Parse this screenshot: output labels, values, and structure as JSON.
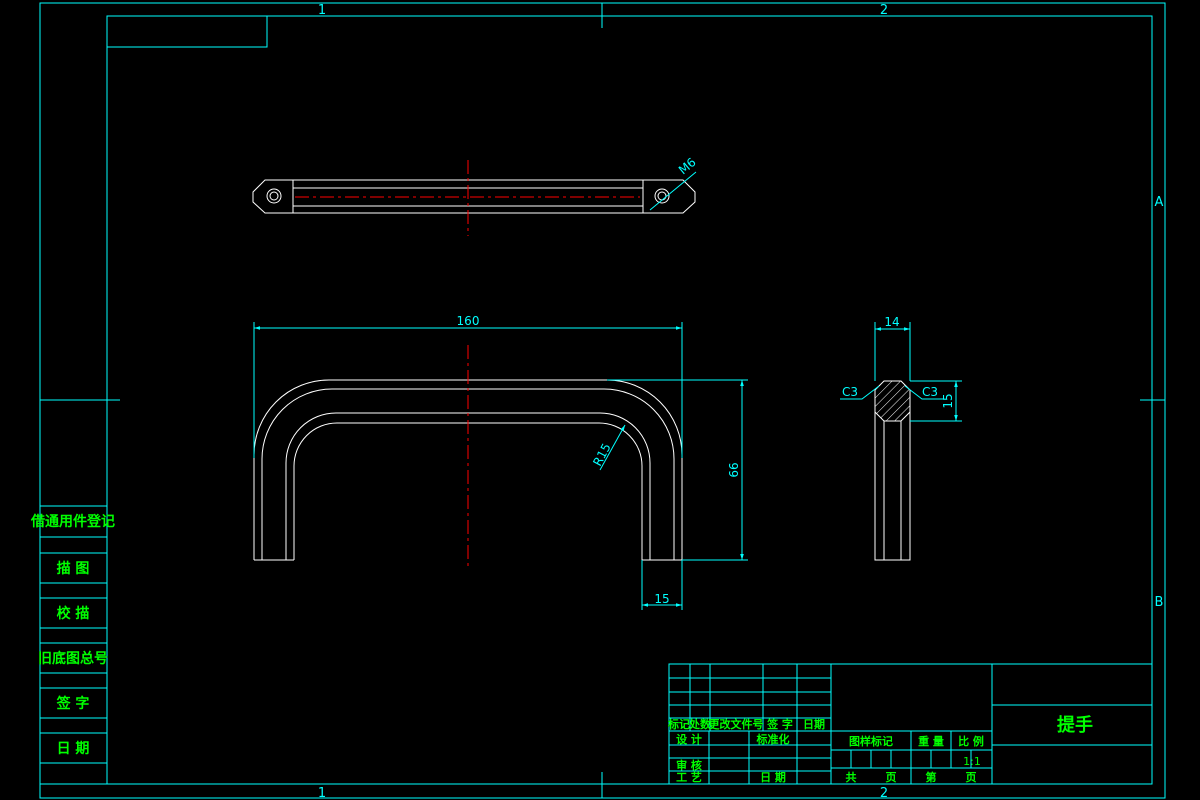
{
  "zone_labels": {
    "top_1": "1",
    "top_2": "2",
    "bottom_1": "1",
    "bottom_2": "2",
    "right_a": "A",
    "right_b": "B"
  },
  "dimensions": {
    "hole_thread": "M6",
    "overall_length": "160",
    "bend_radius": "R15",
    "height": "66",
    "leg_width": "15",
    "section_width": "14",
    "chamfer_left": "C3",
    "chamfer_right": "C3",
    "section_height": "15"
  },
  "left_register": {
    "title": "借通用件登记",
    "rows": [
      "描 图",
      "校 描",
      "旧底图总号",
      "签 字",
      "日 期"
    ]
  },
  "title_block": {
    "rev_headers": [
      "标记",
      "处数",
      "更改文件号",
      "签 字",
      "日期"
    ],
    "design": "设 计",
    "standardization": "标准化",
    "review": "审 核",
    "process": "工 艺",
    "date": "日 期",
    "stage_mark": "图样标记",
    "weight": "重 量",
    "scale_label": "比 例",
    "scale_value": "1:1",
    "total_sheets": "共",
    "sheet_word_1": "页",
    "sheet_no": "第",
    "sheet_word_2": "页",
    "part_name": "提手"
  },
  "colors": {
    "background": "#000000",
    "border": "#00ffff",
    "object": "#ffffff",
    "centerline": "#ff0000",
    "text": "#00ff00",
    "dimension": "#00ffff"
  }
}
